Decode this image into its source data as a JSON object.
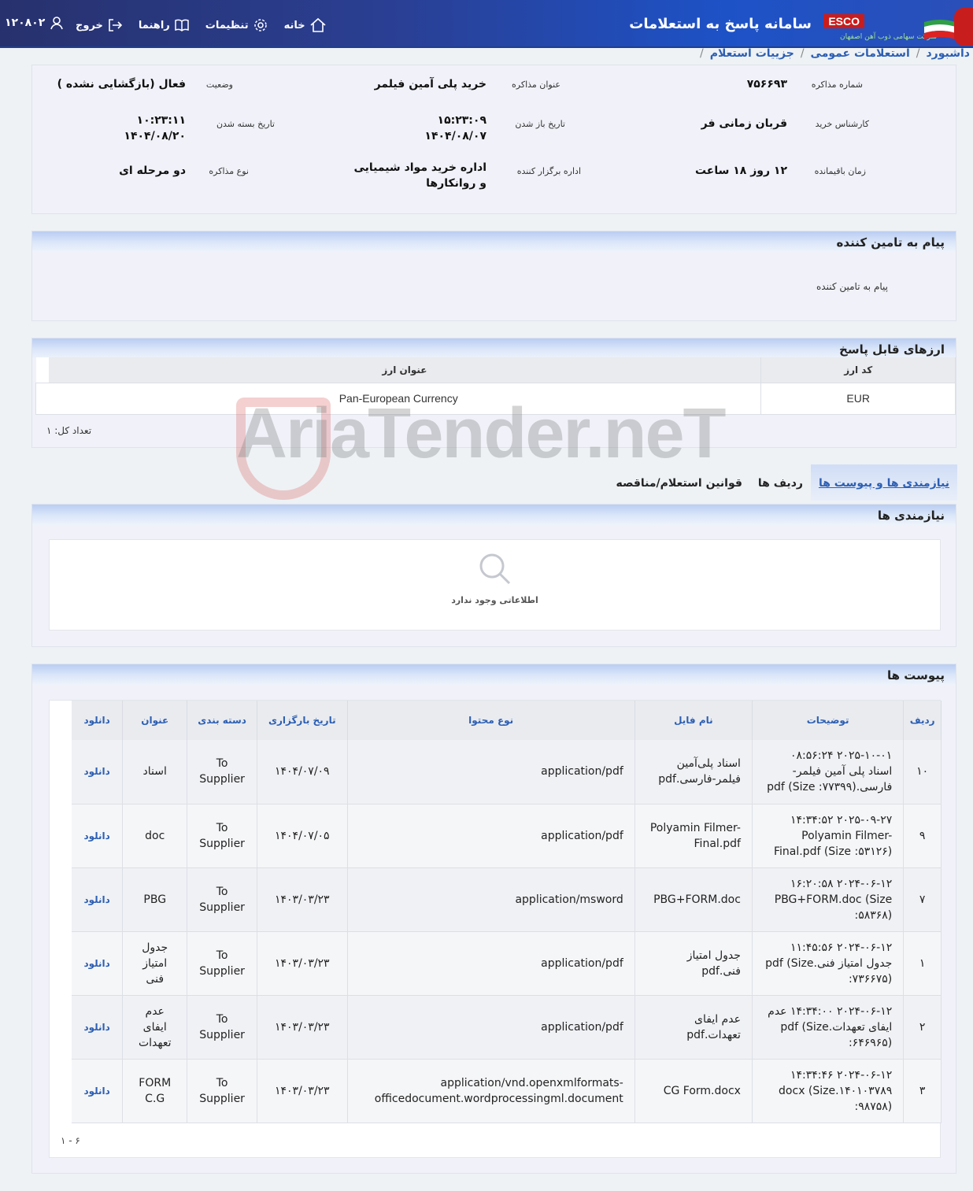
{
  "header": {
    "user_code": "۱۲۰۸۰۲",
    "nav": [
      {
        "label": "خروج",
        "icon": "logout-icon"
      },
      {
        "label": "راهنما",
        "icon": "book-icon"
      },
      {
        "label": "تنظیمات",
        "icon": "gear-icon"
      },
      {
        "label": "خانه",
        "icon": "home-icon"
      }
    ],
    "title": "سامانه پاسخ به استعلامات",
    "logo_text": "ESCO",
    "logo_sub": "شرکت سهامی ذوب آهن اصفهان"
  },
  "breadcrumb": [
    "داشبورد",
    "استعلامات عمومی",
    "جزییات استعلام"
  ],
  "summary": {
    "negotiation_number": {
      "label": "شماره مذاکره",
      "value": "۷۵۶۶۹۳"
    },
    "negotiation_title": {
      "label": "عنوان مذاکره",
      "value": "خرید پلی آمین فیلمر"
    },
    "status": {
      "label": "وضعیت",
      "value": "فعال (بازگشایی نشده )"
    },
    "buyer_expert": {
      "label": "کارشناس خرید",
      "value": "قربان زمانی فر"
    },
    "open_date": {
      "label": "تاریخ باز شدن",
      "time": "۱۵:۲۳:۰۹",
      "date": "۱۴۰۴/۰۸/۰۷"
    },
    "close_date": {
      "label": "تاریخ بسته شدن",
      "time": "۱۰:۲۳:۱۱",
      "date": "۱۴۰۴/۰۸/۲۰"
    },
    "remaining": {
      "label": "زمان باقیمانده",
      "value": "۱۲ روز ۱۸ ساعت"
    },
    "organizer": {
      "label": "اداره برگزار کننده",
      "value": "اداره خرید مواد شیمیایی و روانکارها"
    },
    "negotiation_type": {
      "label": "نوع مذاکره",
      "value": "دو مرحله ای"
    }
  },
  "supplier_message": {
    "title": "پیام به تامین کننده",
    "label": "پیام به تامین کننده"
  },
  "currencies": {
    "title": "ارزهای قابل پاسخ",
    "headers": {
      "code": "کد ارز",
      "name": "عنوان ارز"
    },
    "rows": [
      {
        "code": "EUR",
        "name": "Pan-European Currency"
      }
    ],
    "total": "تعداد کل: ۱"
  },
  "tabs": [
    {
      "label": "نیازمندی ها و پیوست ها",
      "active": true
    },
    {
      "label": "ردیف ها",
      "active": false
    },
    {
      "label": "قوانین استعلام/مناقصه",
      "active": false
    }
  ],
  "requirements": {
    "title": "نیازمندی ها",
    "empty": "اطلاعاتی وجود ندارد"
  },
  "attachments": {
    "title": "پیوست ها",
    "headers": {
      "row": "ردیف",
      "desc": "توضیحات",
      "filename": "نام فایل",
      "mime": "نوع محتوا",
      "upload_date": "تاریخ بارگزاری",
      "category": "دسته بندی",
      "label": "عنوان",
      "download": "دانلود"
    },
    "rows": [
      {
        "row": "۱۰",
        "desc": "۲۰۲۵-۱۰-۰۱ ۰۸:۵۶:۲۴ اسناد پلی آمین فیلمر-فارسی.pdf (Size :۷۷۳۹۹)",
        "filename": "اسناد پلی‌آمین فیلمر-فارسی.pdf",
        "mime": "application/pdf",
        "upload_date": "۱۴۰۴/۰۷/۰۹",
        "category": "To Supplier",
        "label": "اسناد",
        "download": "دانلود"
      },
      {
        "row": "۹",
        "desc": "۲۰۲۵-۰۹-۲۷ ۱۴:۳۴:۵۲ Polyamin Filmer-Final.pdf (Size :۵۳۱۲۶)",
        "filename": "Polyamin Filmer-Final.pdf",
        "mime": "application/pdf",
        "upload_date": "۱۴۰۴/۰۷/۰۵",
        "category": "To Supplier",
        "label": "doc",
        "download": "دانلود"
      },
      {
        "row": "۷",
        "desc": "۲۰۲۴-۰۶-۱۲ ۱۶:۲۰:۵۸ PBG+FORM.doc (Size :۵۸۳۶۸)",
        "filename": "PBG+FORM.doc",
        "mime": "application/msword",
        "upload_date": "۱۴۰۳/۰۳/۲۳",
        "category": "To Supplier",
        "label": "PBG",
        "download": "دانلود"
      },
      {
        "row": "۱",
        "desc": "۲۰۲۴-۰۶-۱۲ ۱۱:۴۵:۵۶ جدول امتیاز فنی.pdf (Size :۷۳۶۶۷۵)",
        "filename": "جدول امتیاز فنی.pdf",
        "mime": "application/pdf",
        "upload_date": "۱۴۰۳/۰۳/۲۳",
        "category": "To Supplier",
        "label": "جدول امتیاز فنی",
        "download": "دانلود"
      },
      {
        "row": "۲",
        "desc": "۲۰۲۴-۰۶-۱۲ ۱۴:۳۴:۰۰ عدم ایفای تعهدات.pdf (Size :۶۴۶۹۶۵)",
        "filename": "عدم ایفای تعهدات.pdf",
        "mime": "application/pdf",
        "upload_date": "۱۴۰۳/۰۳/۲۳",
        "category": "To Supplier",
        "label": "عدم ایفای تعهدات",
        "download": "دانلود"
      },
      {
        "row": "۳",
        "desc": "۲۰۲۴-۰۶-۱۲ ۱۴:۳۴:۴۶ docx (Size.۱۴۰۱۰۳۷۸۹ :۹۸۷۵۸)",
        "filename": "CG Form.docx",
        "mime": "application/vnd.openxmlformats-officedocument.wordprocessingml.document",
        "upload_date": "۱۴۰۳/۰۳/۲۳",
        "category": "To Supplier",
        "label": "FORM C.G",
        "download": "دانلود"
      }
    ],
    "pager": "۱ - ۶"
  },
  "watermark": "AriaTender.neT"
}
